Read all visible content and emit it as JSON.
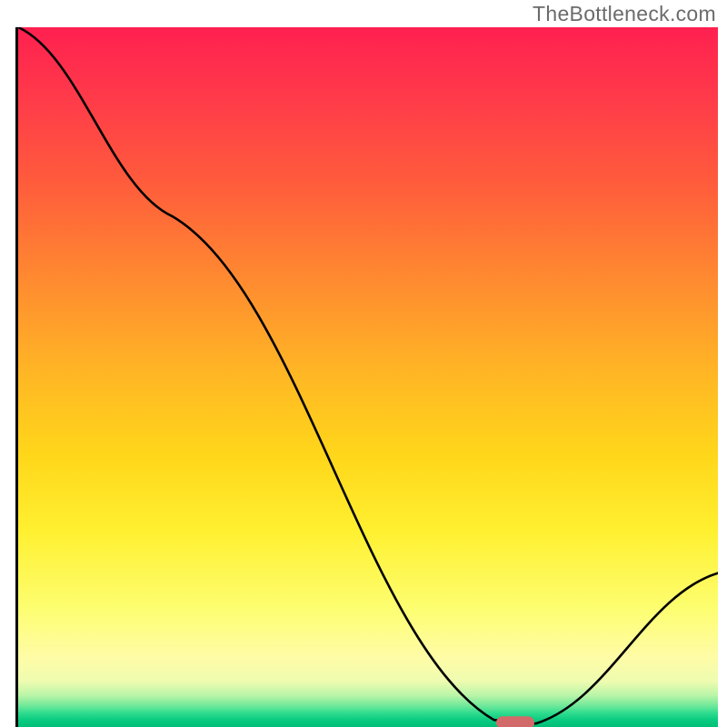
{
  "watermark": "TheBottleneck.com",
  "chart_data": {
    "type": "line",
    "title": "",
    "xlabel": "",
    "ylabel": "",
    "xlim": [
      0,
      100
    ],
    "ylim": [
      0,
      100
    ],
    "grid": false,
    "legend": false,
    "series": [
      {
        "name": "curve",
        "x": [
          0,
          22,
          68,
          74,
          100
        ],
        "y": [
          100,
          73,
          1,
          0.5,
          22
        ]
      }
    ],
    "marker": {
      "x": 71,
      "y": 0.5
    },
    "background_gradient_stops": [
      {
        "pct": 0,
        "color": "#ff2050"
      },
      {
        "pct": 10,
        "color": "#ff3a4a"
      },
      {
        "pct": 22,
        "color": "#ff5b3c"
      },
      {
        "pct": 36,
        "color": "#ff8a30"
      },
      {
        "pct": 50,
        "color": "#ffb824"
      },
      {
        "pct": 61,
        "color": "#ffd61a"
      },
      {
        "pct": 72,
        "color": "#fff030"
      },
      {
        "pct": 83,
        "color": "#fdfe70"
      },
      {
        "pct": 90,
        "color": "#fffca6"
      },
      {
        "pct": 93.5,
        "color": "#eefcb0"
      },
      {
        "pct": 95.5,
        "color": "#b9f5a8"
      },
      {
        "pct": 97,
        "color": "#6de89a"
      },
      {
        "pct": 98,
        "color": "#2fdc8e"
      },
      {
        "pct": 99,
        "color": "#0acb80"
      },
      {
        "pct": 100,
        "color": "#00be78"
      }
    ],
    "marker_color": "#d36a6a",
    "curve_color": "#000000"
  }
}
